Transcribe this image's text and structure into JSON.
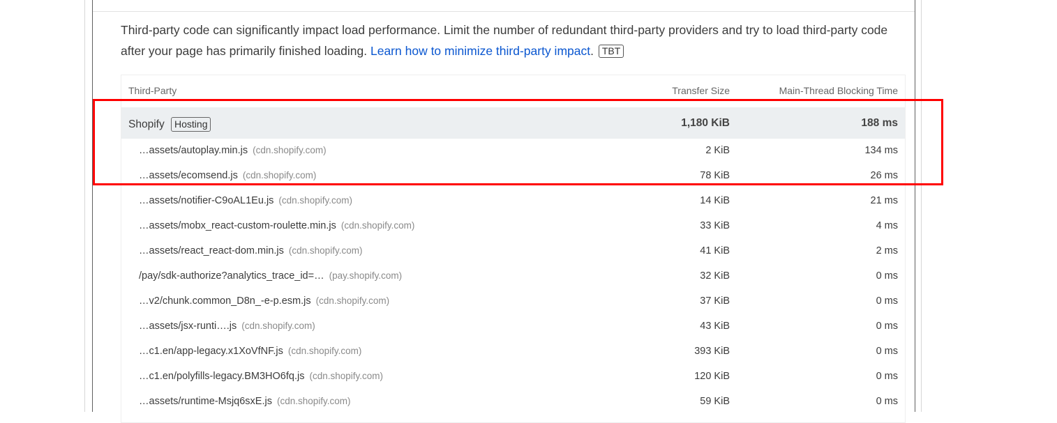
{
  "description": {
    "text": "Third-party code can significantly impact load performance. Limit the number of redundant third-party providers and try to load third-party code after your page has primarily finished loading. ",
    "link": "Learn how to minimize third-party impact",
    "after_link": ".",
    "badge": "TBT"
  },
  "table": {
    "headers": {
      "third_party": "Third-Party",
      "transfer_size": "Transfer Size",
      "blocking_time": "Main-Thread Blocking Time"
    },
    "group": {
      "name": "Shopify",
      "badge": "Hosting",
      "size": "1,180 KiB",
      "tbt": "188 ms"
    },
    "rows": [
      {
        "url": "…assets/autoplay.min.js",
        "host": "(cdn.shopify.com)",
        "size": "2 KiB",
        "tbt": "134 ms"
      },
      {
        "url": "…assets/ecomsend.js",
        "host": "(cdn.shopify.com)",
        "size": "78 KiB",
        "tbt": "26 ms"
      },
      {
        "url": "…assets/notifier-C9oAL1Eu.js",
        "host": "(cdn.shopify.com)",
        "size": "14 KiB",
        "tbt": "21 ms"
      },
      {
        "url": "…assets/mobx_react-custom-roulette.min.js",
        "host": "(cdn.shopify.com)",
        "size": "33 KiB",
        "tbt": "4 ms"
      },
      {
        "url": "…assets/react_react-dom.min.js",
        "host": "(cdn.shopify.com)",
        "size": "41 KiB",
        "tbt": "2 ms"
      },
      {
        "url": "/pay/sdk-authorize?analytics_trace_id=…",
        "host": "(pay.shopify.com)",
        "size": "32 KiB",
        "tbt": "0 ms"
      },
      {
        "url": "…v2/chunk.common_D8n_-e-p.esm.js",
        "host": "(cdn.shopify.com)",
        "size": "37 KiB",
        "tbt": "0 ms"
      },
      {
        "url": "…assets/jsx-runti….js",
        "host": "(cdn.shopify.com)",
        "size": "43 KiB",
        "tbt": "0 ms"
      },
      {
        "url": "…c1.en/app-legacy.x1XoVfNF.js",
        "host": "(cdn.shopify.com)",
        "size": "393 KiB",
        "tbt": "0 ms"
      },
      {
        "url": "…c1.en/polyfills-legacy.BM3HO6fq.js",
        "host": "(cdn.shopify.com)",
        "size": "120 KiB",
        "tbt": "0 ms"
      },
      {
        "url": "…assets/runtime-Msjq6sxE.js",
        "host": "(cdn.shopify.com)",
        "size": "59 KiB",
        "tbt": "0 ms"
      }
    ]
  },
  "colors": {
    "link": "#0b57d0",
    "group_background": "#eceff1",
    "highlight": "#ff0000"
  }
}
